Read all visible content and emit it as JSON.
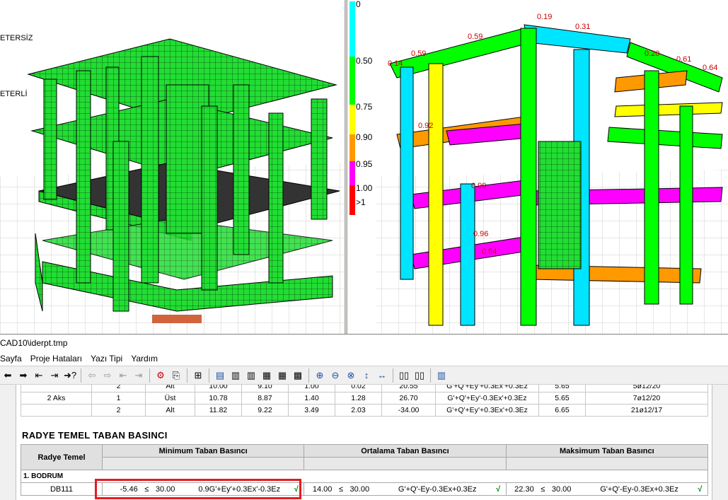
{
  "left_view": {
    "status_labels": [
      "ETERSİZ",
      "ETERLİ"
    ]
  },
  "right_view": {
    "legend": [
      {
        "label": "0",
        "color": "#00ffff"
      },
      {
        "label": "0.50",
        "color": "#00ff00"
      },
      {
        "label": "0.75",
        "color": "#ffff00"
      },
      {
        "label": "0.90",
        "color": "#ff9900"
      },
      {
        "label": "0.95",
        "color": "#ff00ff"
      },
      {
        "label": "1.00",
        "color": "#ff0000"
      },
      {
        "label": ">1",
        "color": "#ff0000"
      }
    ],
    "beam_labels": [
      "0.19",
      "0.31",
      "0.59",
      "0.14",
      "0.59",
      "0.20",
      "0.61",
      "0.64",
      "0.92",
      "0.99",
      "0.96",
      "0.94"
    ]
  },
  "report": {
    "title": "CAD10\\iderpt.tmp",
    "menu": [
      "Sayfa",
      "Proje Hataları",
      "Yazı Tipi",
      "Yardım"
    ],
    "prev_table": {
      "rows": [
        [
          "",
          "2",
          "Alt",
          "10.00",
          "9.10",
          "1.00",
          "0.02",
          "20.55",
          "G'+Q'+Ey'+0.3Ex'+0.3Ez",
          "5.65",
          "5ø12/20"
        ],
        [
          "2 Aks",
          "1",
          "Üst",
          "10.78",
          "8.87",
          "1.40",
          "1.28",
          "26.70",
          "G'+Q'+Ey'-0.3Ex'+0.3Ez",
          "5.65",
          "7ø12/20"
        ],
        [
          "",
          "2",
          "Alt",
          "11.82",
          "9.22",
          "3.49",
          "2.03",
          "-34.00",
          "G'+Q'+Ey'+0.3Ex'+0.3Ez",
          "6.65",
          "21ø12/17"
        ]
      ]
    },
    "rt_title": "RADYE TEMEL TABAN BASINCI",
    "rt_headers": [
      "Radye Temel",
      "Minimum Taban Basıncı",
      "Ortalama Taban Basıncı",
      "Maksimum Taban Basıncı"
    ],
    "section": "1. BODRUM",
    "rt_row": {
      "name": "DB111",
      "min": {
        "value": "-5.46",
        "op": "≤",
        "limit": "30.00",
        "combo": "0.9G'+Ey'+0.3Ex'-0.3Ez",
        "check": "√"
      },
      "avg": {
        "value": "14.00",
        "op": "≤",
        "limit": "30.00",
        "combo": "G'+Q'-Ey-0.3Ex+0.3Ez",
        "check": "√"
      },
      "max": {
        "value": "22.30",
        "op": "≤",
        "limit": "30.00",
        "combo": "G'+Q'-Ey-0.3Ex+0.3Ez",
        "check": "√"
      }
    }
  }
}
